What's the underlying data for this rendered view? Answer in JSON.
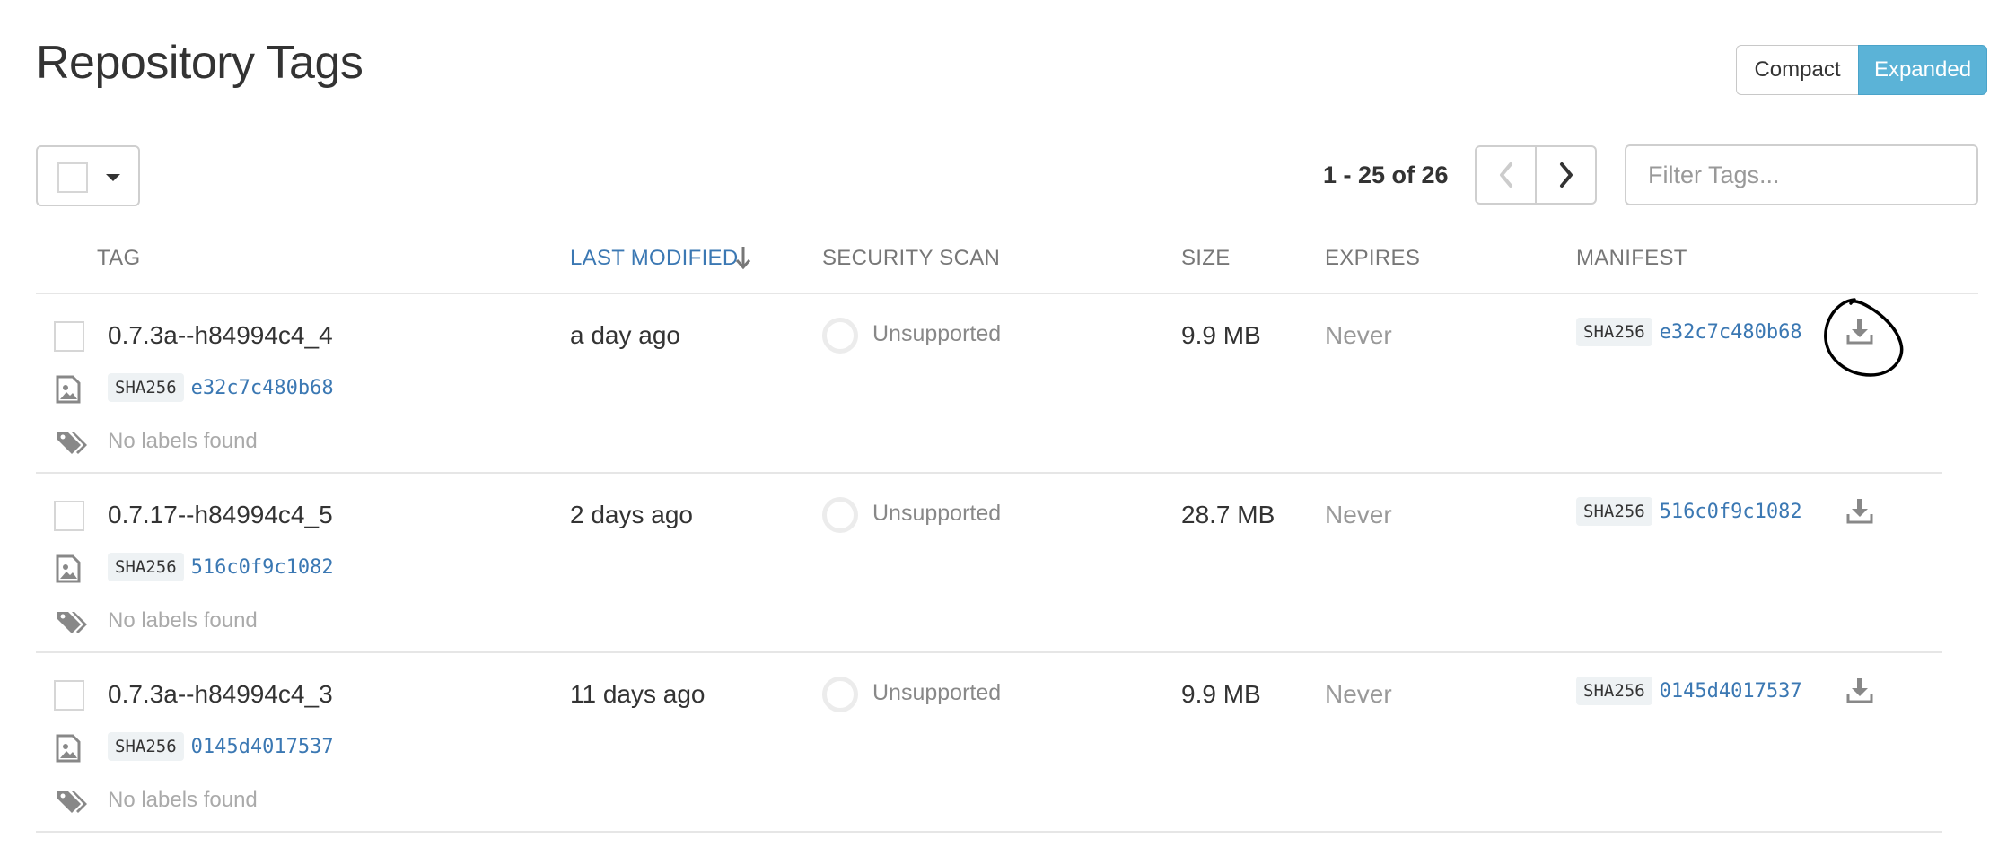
{
  "page_title": "Repository Tags",
  "view_toggle": {
    "compact": "Compact",
    "expanded": "Expanded",
    "active": "expanded"
  },
  "pagination": {
    "text": "1 - 25 of 26"
  },
  "filter": {
    "placeholder": "Filter Tags..."
  },
  "columns": {
    "tag": "TAG",
    "last_modified": "LAST MODIFIED",
    "security_scan": "SECURITY SCAN",
    "size": "SIZE",
    "expires": "EXPIRES",
    "manifest": "MANIFEST"
  },
  "colors": {
    "accent": "#5bb3d7",
    "link": "#3b78b3",
    "annotation": "#000000"
  },
  "rows": [
    {
      "tag": "0.7.3a--h84994c4_4",
      "last_modified": "a day ago",
      "security_scan": "Unsupported",
      "size": "9.9 MB",
      "expires": "Never",
      "manifest_algo": "SHA256",
      "manifest_digest": "e32c7c480b68",
      "image_algo": "SHA256",
      "image_digest": "e32c7c480b68",
      "labels": "No labels found"
    },
    {
      "tag": "0.7.17--h84994c4_5",
      "last_modified": "2 days ago",
      "security_scan": "Unsupported",
      "size": "28.7 MB",
      "expires": "Never",
      "manifest_algo": "SHA256",
      "manifest_digest": "516c0f9c1082",
      "image_algo": "SHA256",
      "image_digest": "516c0f9c1082",
      "labels": "No labels found"
    },
    {
      "tag": "0.7.3a--h84994c4_3",
      "last_modified": "11 days ago",
      "security_scan": "Unsupported",
      "size": "9.9 MB",
      "expires": "Never",
      "manifest_algo": "SHA256",
      "manifest_digest": "0145d4017537",
      "image_algo": "SHA256",
      "image_digest": "0145d4017537",
      "labels": "No labels found"
    }
  ]
}
